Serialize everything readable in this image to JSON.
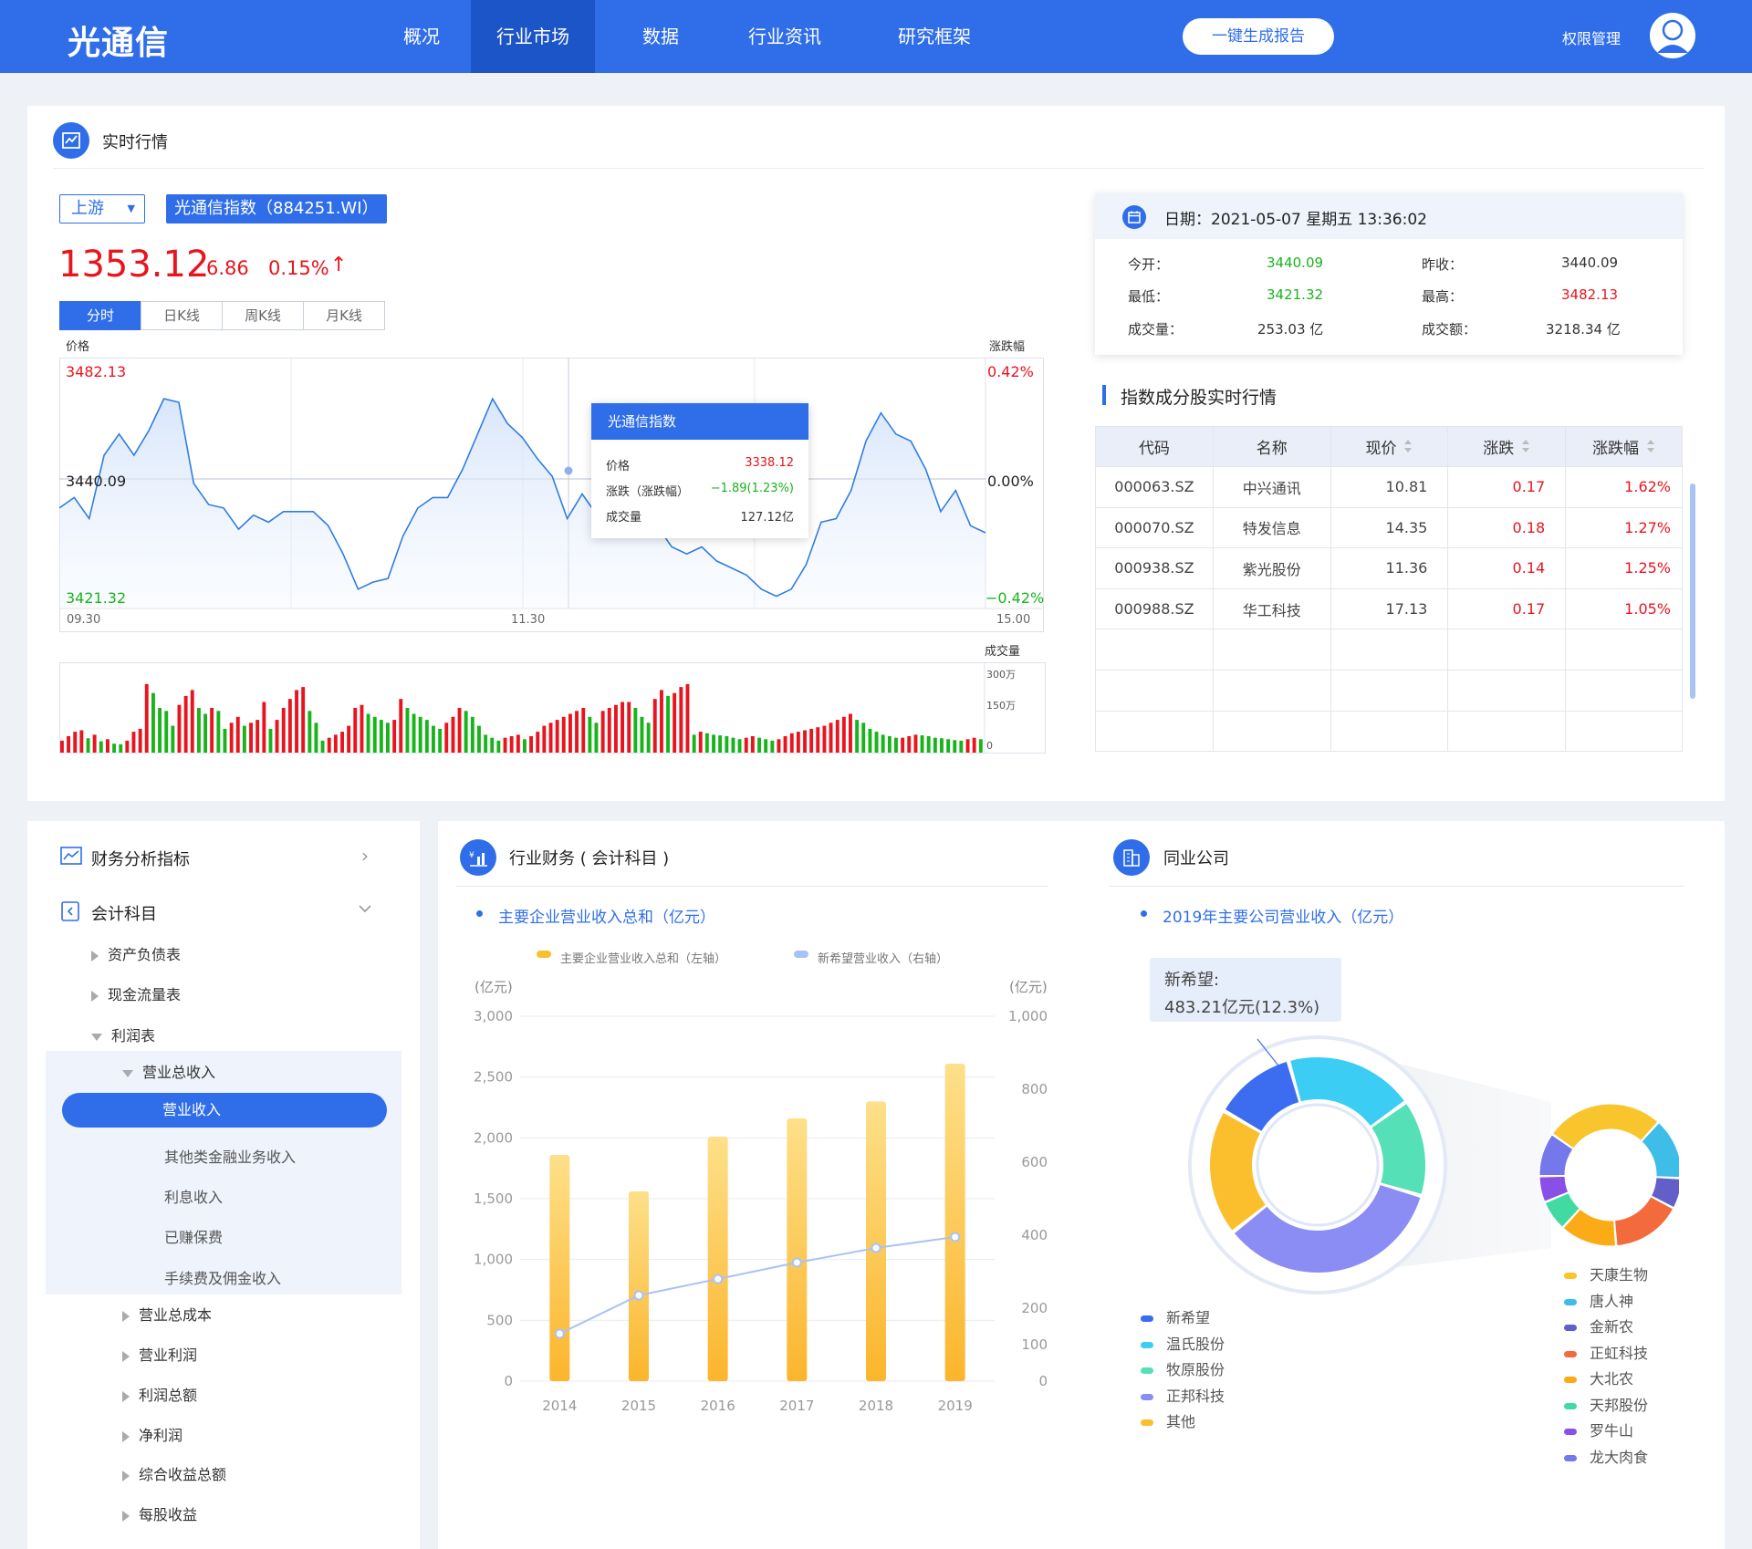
{
  "app": {
    "logo": "光通信"
  },
  "nav": {
    "items": [
      "概况",
      "行业市场",
      "数据",
      "行业资讯",
      "研究框架"
    ],
    "active": 1,
    "report_button": "一键生成报告",
    "permission": "权限管理"
  },
  "realtime": {
    "title": "实时行情",
    "stream_select": "上游",
    "index_label": "光通信指数（884251.WI）",
    "price": "1353.12",
    "change": "6.86",
    "change_pct": "0.15%",
    "tabs": [
      "分时",
      "日K线",
      "周K线",
      "月K线"
    ],
    "active_tab": 0,
    "axis_price_label": "价格",
    "axis_pct_label": "涨跌幅",
    "y_left": [
      "3482.13",
      "3440.09",
      "3421.32"
    ],
    "y_right": [
      "0.42%",
      "0.00%",
      "−0.42%"
    ],
    "x_ticks": [
      "09.30",
      "11.30",
      "15.00"
    ],
    "volume_label": "成交量",
    "volume_ticks": [
      "300万",
      "150万",
      "0"
    ],
    "tooltip": {
      "title": "光通信指数",
      "rows": [
        {
          "k": "价格",
          "v": "3338.12"
        },
        {
          "k": "涨跌（涨跌幅）",
          "v": "−1.89(1.23%)"
        },
        {
          "k": "成交量",
          "v": "127.12亿"
        }
      ]
    }
  },
  "quote": {
    "date": "日期：2021-05-07 星期五 13:36:02",
    "rows": [
      {
        "k1": "今开：",
        "v1": "3440.09",
        "k2": "昨收：",
        "v2": "3440.09"
      },
      {
        "k1": "最低：",
        "v1": "3421.32",
        "k2": "最高：",
        "v2": "3482.13"
      },
      {
        "k1": "成交量：",
        "v1": "253.03 亿",
        "k2": "成交额：",
        "v2": "3218.34 亿"
      }
    ]
  },
  "constituents": {
    "title": "指数成分股实时行情",
    "headers": [
      "代码",
      "名称",
      "现价",
      "涨跌",
      "涨跌幅"
    ],
    "rows": [
      [
        "000063.SZ",
        "中兴通讯",
        "10.81",
        "0.17",
        "1.62%"
      ],
      [
        "000070.SZ",
        "特发信息",
        "14.35",
        "0.18",
        "1.27%"
      ],
      [
        "000938.SZ",
        "紫光股份",
        "11.36",
        "0.14",
        "1.25%"
      ],
      [
        "000988.SZ",
        "华工科技",
        "17.13",
        "0.17",
        "1.05%"
      ]
    ]
  },
  "sidebar": {
    "sections": [
      {
        "label": "财务分析指标"
      },
      {
        "label": "会计科目"
      }
    ],
    "items": [
      {
        "label": "资产负债表",
        "level": 1,
        "open": false
      },
      {
        "label": "现金流量表",
        "level": 1,
        "open": false
      },
      {
        "label": "利润表",
        "level": 1,
        "open": true
      },
      {
        "label": "营业总收入",
        "level": 2,
        "open": true
      },
      {
        "label": "营业收入",
        "level": 3,
        "selected": true
      },
      {
        "label": "其他类金融业务收入",
        "level": 3
      },
      {
        "label": "利息收入",
        "level": 3
      },
      {
        "label": "已赚保费",
        "level": 3
      },
      {
        "label": "手续费及佣金收入",
        "level": 3
      },
      {
        "label": "营业总成本",
        "level": 2,
        "open": false
      },
      {
        "label": "营业利润",
        "level": 2,
        "open": false
      },
      {
        "label": "利润总额",
        "level": 2,
        "open": false
      },
      {
        "label": "净利润",
        "level": 2,
        "open": false
      },
      {
        "label": "综合收益总额",
        "level": 2,
        "open": false
      },
      {
        "label": "每股收益",
        "level": 2,
        "open": false
      }
    ]
  },
  "finance": {
    "title": "行业财务 ( 会计科目 )",
    "subtitle": "主要企业营业收入总和（亿元）",
    "legend": [
      "主要企业营业收入总和（左轴）",
      "新希望营业收入（右轴）"
    ],
    "unit_left": "(亿元)",
    "unit_right": "(亿元)"
  },
  "peers": {
    "title": "同业公司",
    "subtitle": "2019年主要公司营业收入（亿元）",
    "tooltip_line1": "新希望:",
    "tooltip_line2": "483.21亿元(12.3%)",
    "legend_left": [
      {
        "name": "新希望",
        "color": "#3c6cf0"
      },
      {
        "name": "温氏股份",
        "color": "#3ccdf5"
      },
      {
        "name": "牧原股份",
        "color": "#55e0b8"
      },
      {
        "name": "正邦科技",
        "color": "#8c8cf5"
      },
      {
        "name": "其他",
        "color": "#fbbf2e"
      }
    ],
    "legend_right": [
      {
        "name": "天康生物",
        "color": "#f8c52c"
      },
      {
        "name": "唐人神",
        "color": "#3dbde8"
      },
      {
        "name": "金新农",
        "color": "#6260c8"
      },
      {
        "name": "正虹科技",
        "color": "#f36a3c"
      },
      {
        "name": "大北农",
        "color": "#fbab16"
      },
      {
        "name": "天邦股份",
        "color": "#43d9a2"
      },
      {
        "name": "罗牛山",
        "color": "#8950e8"
      },
      {
        "name": "龙大肉食",
        "color": "#7478ea"
      }
    ]
  },
  "chart_data": [
    {
      "type": "line",
      "title": "",
      "xlabel": "",
      "ylabel": "价格",
      "ylim": [
        3421.32,
        3482.13
      ],
      "x": [
        "09.30",
        "11.30",
        "15.00"
      ],
      "series": [
        {
          "name": "光通信指数",
          "values": [
            3441,
            3444,
            3438,
            3456,
            3462,
            3456,
            3463,
            3472,
            3471,
            3448,
            3442,
            3441,
            3435,
            3439,
            3437,
            3440,
            3440,
            3440,
            3436,
            3428,
            3418,
            3420,
            3421,
            3433,
            3441,
            3444,
            3444,
            3452,
            3462,
            3472,
            3465,
            3461,
            3455,
            3450,
            3438,
            3445,
            3439,
            3437,
            3438,
            3442,
            3436,
            3430,
            3428,
            3430,
            3426,
            3424,
            3422,
            3418,
            3416,
            3418,
            3425,
            3437,
            3438,
            3446,
            3460,
            3468,
            3462,
            3460,
            3452,
            3440,
            3446,
            3436,
            3434
          ]
        }
      ],
      "grid": true
    },
    {
      "type": "bar",
      "title": "",
      "ylabel": "成交量",
      "ylim": [
        0,
        300
      ],
      "series": [
        {
          "name": "成交量",
          "values": [
            40,
            55,
            70,
            75,
            48,
            60,
            38,
            45,
            30,
            28,
            40,
            70,
            80,
            230,
            200,
            150,
            140,
            90,
            160,
            190,
            210,
            150,
            130,
            150,
            140,
            80,
            100,
            120,
            90,
            100,
            110,
            170,
            80,
            110,
            150,
            180,
            210,
            220,
            140,
            100,
            40,
            50,
            60,
            70,
            90,
            150,
            160,
            130,
            120,
            110,
            100,
            110,
            180,
            150,
            130,
            120,
            110,
            90,
            80,
            100,
            120,
            150,
            140,
            120,
            90,
            60,
            50,
            40,
            50,
            55,
            60,
            45,
            55,
            70,
            90,
            100,
            110,
            120,
            130,
            140,
            150,
            120,
            100,
            140,
            150,
            160,
            170,
            170,
            150,
            120,
            100,
            180,
            210,
            190,
            200,
            220,
            230,
            60,
            70,
            65,
            60,
            58,
            55,
            50,
            45,
            50,
            55,
            50,
            45,
            40,
            45,
            55,
            65,
            70,
            75,
            80,
            85,
            90,
            100,
            110,
            120,
            130,
            110,
            100,
            80,
            70,
            60,
            55,
            50,
            50,
            55,
            60,
            58,
            55,
            50,
            48,
            45,
            42,
            40,
            45,
            50,
            45
          ]
        }
      ]
    },
    {
      "type": "bar",
      "title": "主要企业营业收入总和（亿元）",
      "categories": [
        "2014",
        "2015",
        "2016",
        "2017",
        "2018",
        "2019"
      ],
      "ylim": [
        0,
        3000
      ],
      "ylim_right": [
        0,
        1000
      ],
      "y_ticks_left": [
        "0",
        "500",
        "1,000",
        "1,500",
        "2,000",
        "2,500",
        "3,000"
      ],
      "y_ticks_right": [
        "0",
        "100",
        "200",
        "300",
        "400",
        "500",
        "600",
        "700",
        "800",
        "900",
        "1,000"
      ],
      "y_ticks_right_shown": [
        "0",
        "100",
        "200",
        "400",
        "600",
        "800",
        "1,000"
      ],
      "series": [
        {
          "name": "主要企业营业收入总和（左轴）",
          "type": "bar",
          "axis": "left",
          "values": [
            1860,
            1560,
            2010,
            2160,
            2300,
            2610
          ],
          "color": "#fbbf2e"
        },
        {
          "name": "新希望营业收入（右轴）",
          "type": "line",
          "axis": "right",
          "values": [
            130,
            235,
            280,
            325,
            365,
            395
          ],
          "color": "#a9c2f5"
        }
      ],
      "legend": "top"
    },
    {
      "type": "pie",
      "title": "2019年主要公司营业收入（亿元）",
      "series": [
        {
          "name": "新希望",
          "value": 12.3,
          "color": "#3c6cf0"
        },
        {
          "name": "温氏股份",
          "value": 19.5,
          "color": "#3ccdf5"
        },
        {
          "name": "牧原股份",
          "value": 14.5,
          "color": "#55e0b8"
        },
        {
          "name": "正邦科技",
          "value": 34.7,
          "color": "#8c8cf5"
        },
        {
          "name": "其他",
          "value": 19.0,
          "color": "#fbbf2e"
        }
      ]
    },
    {
      "type": "pie",
      "title": "其他",
      "series": [
        {
          "name": "天康生物",
          "value": 27,
          "color": "#f8c52c"
        },
        {
          "name": "唐人神",
          "value": 14,
          "color": "#3dbde8"
        },
        {
          "name": "金新农",
          "value": 7,
          "color": "#6260c8"
        },
        {
          "name": "正虹科技",
          "value": 16,
          "color": "#f36a3c"
        },
        {
          "name": "大北农",
          "value": 13,
          "color": "#fbab16"
        },
        {
          "name": "天邦股份",
          "value": 7,
          "color": "#43d9a2"
        },
        {
          "name": "罗牛山",
          "value": 6,
          "color": "#8950e8"
        },
        {
          "name": "龙大肉食",
          "value": 10,
          "color": "#7478ea"
        }
      ]
    }
  ]
}
